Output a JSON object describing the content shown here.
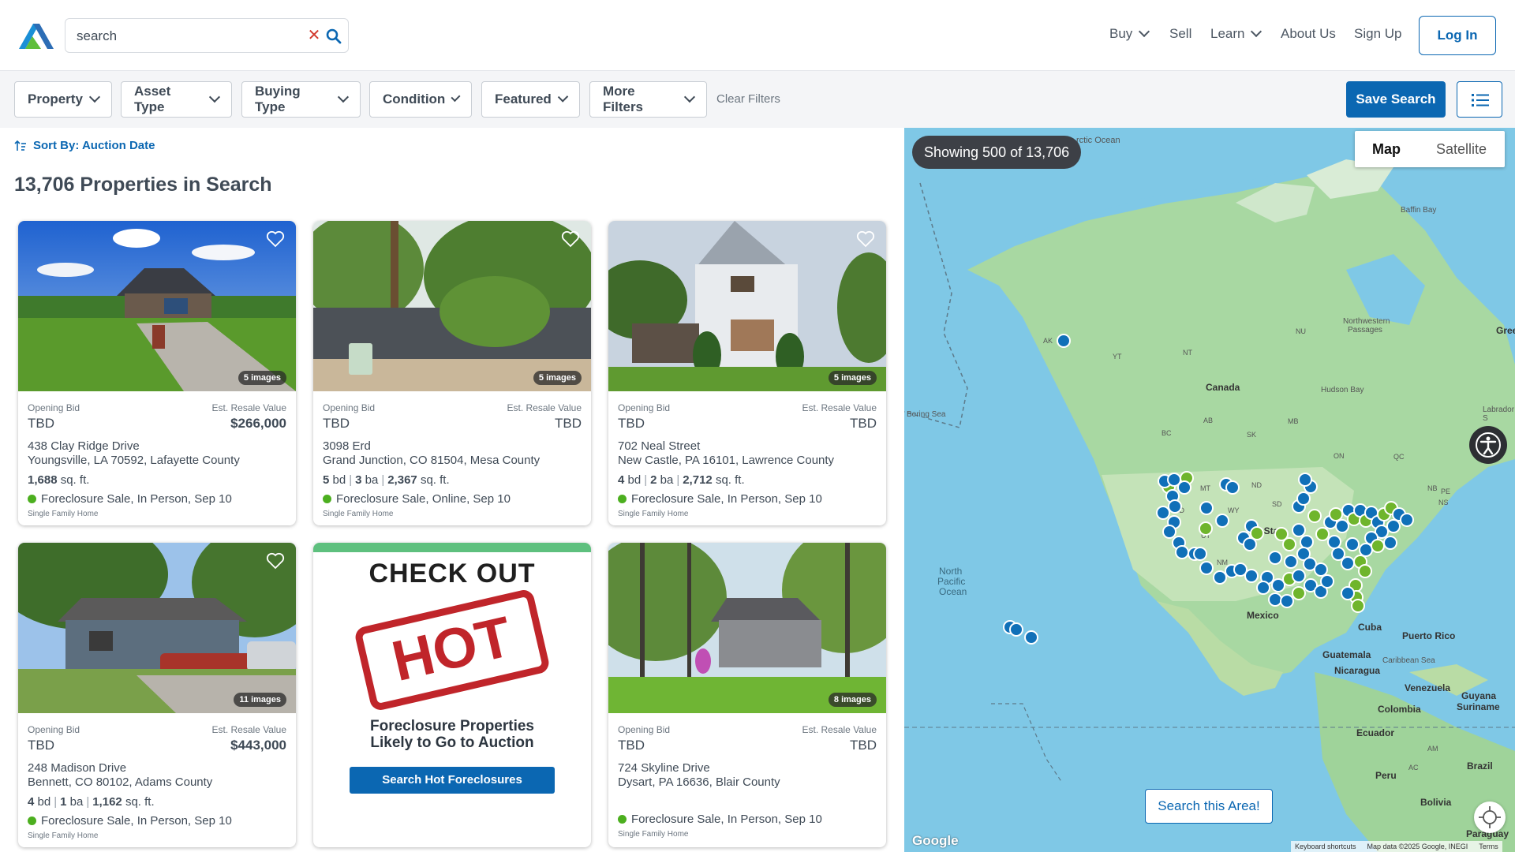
{
  "header": {
    "search_value": "search",
    "nav": {
      "buy": "Buy",
      "sell": "Sell",
      "learn": "Learn",
      "about": "About Us",
      "signup": "Sign Up",
      "login": "Log In"
    }
  },
  "filters": {
    "property": "Property",
    "asset_type": "Asset Type",
    "buying_type": "Buying Type",
    "condition": "Condition",
    "featured": "Featured",
    "more_filters": "More Filters",
    "clear_filters": "Clear Filters",
    "save_search": "Save Search"
  },
  "results": {
    "sort_by": "Sort By: Auction Date",
    "count_title": "13,706 Properties in Search",
    "cards": [
      {
        "images": "5 images",
        "opening_bid_label": "Opening Bid",
        "opening_bid": "TBD",
        "resale_label": "Est. Resale Value",
        "resale": "$266,000",
        "address1": "438 Clay Ridge Drive",
        "address2": "Youngsville, LA 70592, Lafayette County",
        "bd": "",
        "ba": "",
        "sqft": "1,688",
        "sqft_unit": "sq. ft.",
        "sale": "Foreclosure Sale, In Person, Sep 10",
        "type": "Single Family Home"
      },
      {
        "images": "5 images",
        "opening_bid_label": "Opening Bid",
        "opening_bid": "TBD",
        "resale_label": "Est. Resale Value",
        "resale": "TBD",
        "address1": "3098 Erd",
        "address2": "Grand Junction, CO 81504, Mesa County",
        "bd": "5",
        "ba": "3",
        "sqft": "2,367",
        "sqft_unit": "sq. ft.",
        "sale": "Foreclosure Sale, Online, Sep 10",
        "type": "Single Family Home"
      },
      {
        "images": "5 images",
        "opening_bid_label": "Opening Bid",
        "opening_bid": "TBD",
        "resale_label": "Est. Resale Value",
        "resale": "TBD",
        "address1": "702 Neal Street",
        "address2": "New Castle, PA 16101, Lawrence County",
        "bd": "4",
        "ba": "2",
        "sqft": "2,712",
        "sqft_unit": "sq. ft.",
        "sale": "Foreclosure Sale, In Person, Sep 10",
        "type": "Single Family Home"
      },
      {
        "images": "11 images",
        "opening_bid_label": "Opening Bid",
        "opening_bid": "TBD",
        "resale_label": "Est. Resale Value",
        "resale": "$443,000",
        "address1": "248 Madison Drive",
        "address2": "Bennett, CO 80102, Adams County",
        "bd": "4",
        "ba": "1",
        "sqft": "1,162",
        "sqft_unit": "sq. ft.",
        "sale": "Foreclosure Sale, In Person, Sep 10",
        "type": "Single Family Home"
      },
      {
        "images": "8 images",
        "opening_bid_label": "Opening Bid",
        "opening_bid": "TBD",
        "resale_label": "Est. Resale Value",
        "resale": "TBD",
        "address1": "724 Skyline Drive",
        "address2": "Dysart, PA 16636, Blair County",
        "bd": "",
        "ba": "",
        "sqft": "",
        "sqft_unit": "",
        "sale": "Foreclosure Sale, In Person, Sep 10",
        "type": "Single Family Home"
      }
    ],
    "promo": {
      "headline": "CHECK OUT",
      "stamp": "HOT",
      "line1": "Foreclosure Properties",
      "line2": "Likely to Go to Auction",
      "button": "Search Hot Foreclosures"
    }
  },
  "map": {
    "showing": "Showing 500 of 13,706",
    "type_map": "Map",
    "type_satellite": "Satellite",
    "search_area": "Search this Area!",
    "google": "Google",
    "attribution": {
      "shortcuts": "Keyboard shortcuts",
      "data": "Map data ©2025 Google, INEGI",
      "terms": "Terms"
    },
    "labels": {
      "arctic": "rctic Ocean",
      "baffin": "Baffin Bay",
      "greenland": "Gree",
      "nw_passages_1": "Northwestern",
      "nw_passages_2": "Passages",
      "ak": "AK",
      "yt": "YT",
      "nt": "NT",
      "nu": "NU",
      "canada": "Canada",
      "hudson": "Hudson Bay",
      "labrador": "Labrador S",
      "bering": "Bering Sea",
      "bc": "BC",
      "ab": "AB",
      "sk": "SK",
      "mb": "MB",
      "on": "ON",
      "qc": "QC",
      "nb": "NB",
      "pe": "PE",
      "ns": "NS",
      "mt": "MT",
      "nd": "ND",
      "sd": "SD",
      "wy": "WY",
      "id": "ID",
      "nv": "NV",
      "ut": "UT",
      "nm": "NM",
      "sta": "d Sta",
      "npo_1": "North",
      "npo_2": "Pacific",
      "npo_3": "Ocean",
      "mexico": "Mexico",
      "cuba": "Cuba",
      "pr": "Puerto Rico",
      "guatemala": "Guatemala",
      "nicaragua": "Nicaragua",
      "caribbean": "Caribbean Sea",
      "venezuela": "Venezuela",
      "guyana": "Guyana",
      "suriname": "Suriname",
      "colombia": "Colombia",
      "ecuador": "Ecuador",
      "am": "AM",
      "brazil": "Brazil",
      "peru": "Peru",
      "ac": "AC",
      "bolivia": "Bolivia",
      "paraguay": "Paraguay"
    }
  },
  "colors": {
    "brand_blue": "#0b67b2",
    "green_status": "#4caf1f",
    "marker_blue": "#1070b8",
    "marker_green": "#6fb52c",
    "hot_red": "#c0252a"
  }
}
